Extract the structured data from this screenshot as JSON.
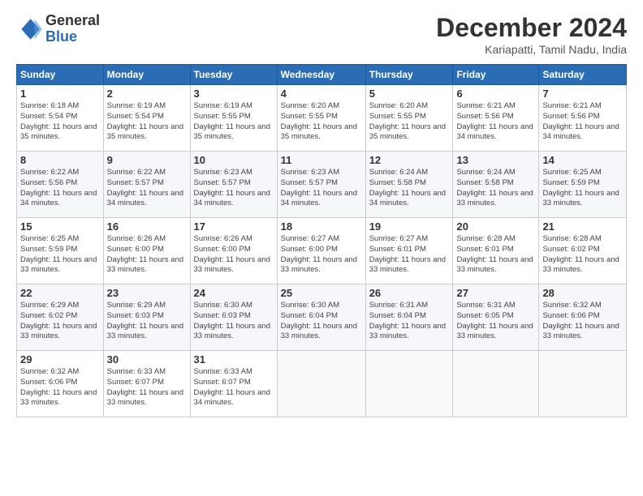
{
  "header": {
    "logo_general": "General",
    "logo_blue": "Blue",
    "month_title": "December 2024",
    "location": "Kariapatti, Tamil Nadu, India"
  },
  "days_of_week": [
    "Sunday",
    "Monday",
    "Tuesday",
    "Wednesday",
    "Thursday",
    "Friday",
    "Saturday"
  ],
  "weeks": [
    [
      {
        "day": "1",
        "sunrise": "6:18 AM",
        "sunset": "5:54 PM",
        "daylight": "11 hours and 35 minutes."
      },
      {
        "day": "2",
        "sunrise": "6:19 AM",
        "sunset": "5:54 PM",
        "daylight": "11 hours and 35 minutes."
      },
      {
        "day": "3",
        "sunrise": "6:19 AM",
        "sunset": "5:55 PM",
        "daylight": "11 hours and 35 minutes."
      },
      {
        "day": "4",
        "sunrise": "6:20 AM",
        "sunset": "5:55 PM",
        "daylight": "11 hours and 35 minutes."
      },
      {
        "day": "5",
        "sunrise": "6:20 AM",
        "sunset": "5:55 PM",
        "daylight": "11 hours and 35 minutes."
      },
      {
        "day": "6",
        "sunrise": "6:21 AM",
        "sunset": "5:56 PM",
        "daylight": "11 hours and 34 minutes."
      },
      {
        "day": "7",
        "sunrise": "6:21 AM",
        "sunset": "5:56 PM",
        "daylight": "11 hours and 34 minutes."
      }
    ],
    [
      {
        "day": "8",
        "sunrise": "6:22 AM",
        "sunset": "5:56 PM",
        "daylight": "11 hours and 34 minutes."
      },
      {
        "day": "9",
        "sunrise": "6:22 AM",
        "sunset": "5:57 PM",
        "daylight": "11 hours and 34 minutes."
      },
      {
        "day": "10",
        "sunrise": "6:23 AM",
        "sunset": "5:57 PM",
        "daylight": "11 hours and 34 minutes."
      },
      {
        "day": "11",
        "sunrise": "6:23 AM",
        "sunset": "5:57 PM",
        "daylight": "11 hours and 34 minutes."
      },
      {
        "day": "12",
        "sunrise": "6:24 AM",
        "sunset": "5:58 PM",
        "daylight": "11 hours and 34 minutes."
      },
      {
        "day": "13",
        "sunrise": "6:24 AM",
        "sunset": "5:58 PM",
        "daylight": "11 hours and 33 minutes."
      },
      {
        "day": "14",
        "sunrise": "6:25 AM",
        "sunset": "5:59 PM",
        "daylight": "11 hours and 33 minutes."
      }
    ],
    [
      {
        "day": "15",
        "sunrise": "6:25 AM",
        "sunset": "5:59 PM",
        "daylight": "11 hours and 33 minutes."
      },
      {
        "day": "16",
        "sunrise": "6:26 AM",
        "sunset": "6:00 PM",
        "daylight": "11 hours and 33 minutes."
      },
      {
        "day": "17",
        "sunrise": "6:26 AM",
        "sunset": "6:00 PM",
        "daylight": "11 hours and 33 minutes."
      },
      {
        "day": "18",
        "sunrise": "6:27 AM",
        "sunset": "6:00 PM",
        "daylight": "11 hours and 33 minutes."
      },
      {
        "day": "19",
        "sunrise": "6:27 AM",
        "sunset": "6:01 PM",
        "daylight": "11 hours and 33 minutes."
      },
      {
        "day": "20",
        "sunrise": "6:28 AM",
        "sunset": "6:01 PM",
        "daylight": "11 hours and 33 minutes."
      },
      {
        "day": "21",
        "sunrise": "6:28 AM",
        "sunset": "6:02 PM",
        "daylight": "11 hours and 33 minutes."
      }
    ],
    [
      {
        "day": "22",
        "sunrise": "6:29 AM",
        "sunset": "6:02 PM",
        "daylight": "11 hours and 33 minutes."
      },
      {
        "day": "23",
        "sunrise": "6:29 AM",
        "sunset": "6:03 PM",
        "daylight": "11 hours and 33 minutes."
      },
      {
        "day": "24",
        "sunrise": "6:30 AM",
        "sunset": "6:03 PM",
        "daylight": "11 hours and 33 minutes."
      },
      {
        "day": "25",
        "sunrise": "6:30 AM",
        "sunset": "6:04 PM",
        "daylight": "11 hours and 33 minutes."
      },
      {
        "day": "26",
        "sunrise": "6:31 AM",
        "sunset": "6:04 PM",
        "daylight": "11 hours and 33 minutes."
      },
      {
        "day": "27",
        "sunrise": "6:31 AM",
        "sunset": "6:05 PM",
        "daylight": "11 hours and 33 minutes."
      },
      {
        "day": "28",
        "sunrise": "6:32 AM",
        "sunset": "6:06 PM",
        "daylight": "11 hours and 33 minutes."
      }
    ],
    [
      {
        "day": "29",
        "sunrise": "6:32 AM",
        "sunset": "6:06 PM",
        "daylight": "11 hours and 33 minutes."
      },
      {
        "day": "30",
        "sunrise": "6:33 AM",
        "sunset": "6:07 PM",
        "daylight": "11 hours and 33 minutes."
      },
      {
        "day": "31",
        "sunrise": "6:33 AM",
        "sunset": "6:07 PM",
        "daylight": "11 hours and 34 minutes."
      },
      null,
      null,
      null,
      null
    ]
  ]
}
